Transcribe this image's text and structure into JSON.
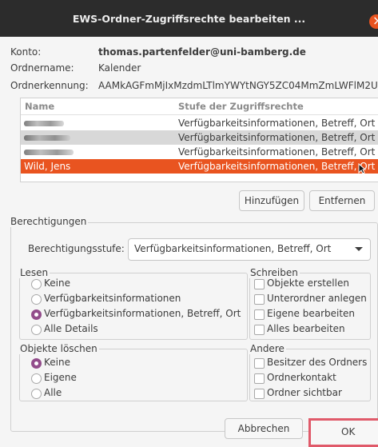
{
  "window": {
    "title": "EWS-Ordner-Zugriffsrechte bearbeiten ..."
  },
  "account": {
    "label": "Konto:",
    "value": "thomas.partenfelder@uni-bamberg.de"
  },
  "folder": {
    "label": "Ordnername:",
    "value": "Kalender"
  },
  "folder_id": {
    "label": "Ordnerkennung:",
    "value": "AAMkAGFmMjIxMzdmLTlmYWYtNGY5ZC04MmZmLWFlM2U"
  },
  "table": {
    "headers": [
      "Name",
      "Stufe der Zugriffsrechte"
    ],
    "rows": [
      {
        "name": "",
        "level": "Verfügbarkeitsinformationen, Betreff, Ort"
      },
      {
        "name": "",
        "level": "Verfügbarkeitsinformationen, Betreff, Ort"
      },
      {
        "name": "",
        "level": "Verfügbarkeitsinformationen, Betreff, Ort"
      },
      {
        "name": "Wild, Jens",
        "level": "Verfügbarkeitsinformationen, Betreff, Ort"
      }
    ],
    "selected_color": "#e95420"
  },
  "buttons": {
    "add": "Hinzufügen",
    "remove": "Entfernen",
    "cancel": "Abbrechen",
    "ok": "OK"
  },
  "permissions": {
    "label": "Berechtigungen",
    "level_label": "Berechtigungsstufe:",
    "level_value": "Verfügbarkeitsinformationen, Betreff, Ort"
  },
  "read": {
    "label": "Lesen",
    "options": [
      "Keine",
      "Verfügbarkeitsinformationen",
      "Verfügbarkeitsinformationen, Betreff, Ort",
      "Alle Details"
    ],
    "selected": 2
  },
  "write": {
    "label": "Schreiben",
    "options": [
      "Objekte erstellen",
      "Unterordner anlegen",
      "Eigene bearbeiten",
      "Alles bearbeiten"
    ]
  },
  "delete": {
    "label": "Objekte löschen",
    "options": [
      "Keine",
      "Eigene",
      "Alle"
    ],
    "selected": 0
  },
  "other": {
    "label": "Andere",
    "options": [
      "Besitzer des Ordners",
      "Ordnerkontakt",
      "Ordner sichtbar"
    ]
  },
  "colors": {
    "titlebar": "#2c2c2c",
    "accent": "#924d8b",
    "selection": "#e95420",
    "close": "#e95420"
  }
}
